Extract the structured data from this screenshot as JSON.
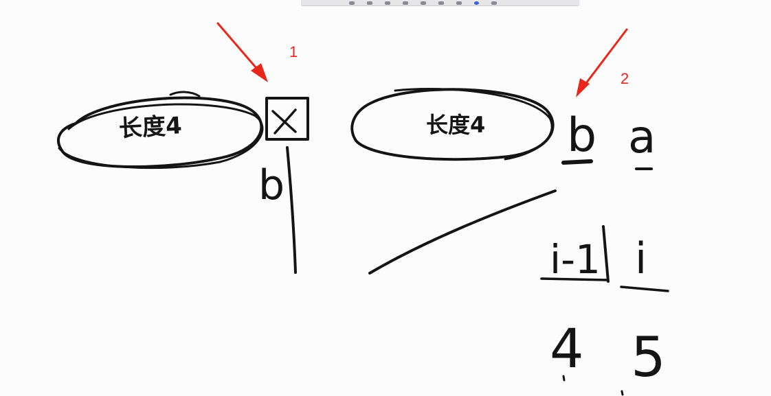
{
  "callouts": [
    {
      "label": "1"
    },
    {
      "label": "2"
    }
  ],
  "sketch": {
    "oval_left_text": "长度4",
    "oval_right_text": "长度4",
    "box_glyph": "X",
    "box_below": "b",
    "pair_letters": [
      "b",
      "a"
    ],
    "index_labels": [
      "i-1",
      "i"
    ],
    "index_values": [
      "4",
      "5"
    ]
  },
  "colors": {
    "ink": "#141414",
    "annotation": "#e8261a",
    "canvas": "#fdfcfc"
  }
}
